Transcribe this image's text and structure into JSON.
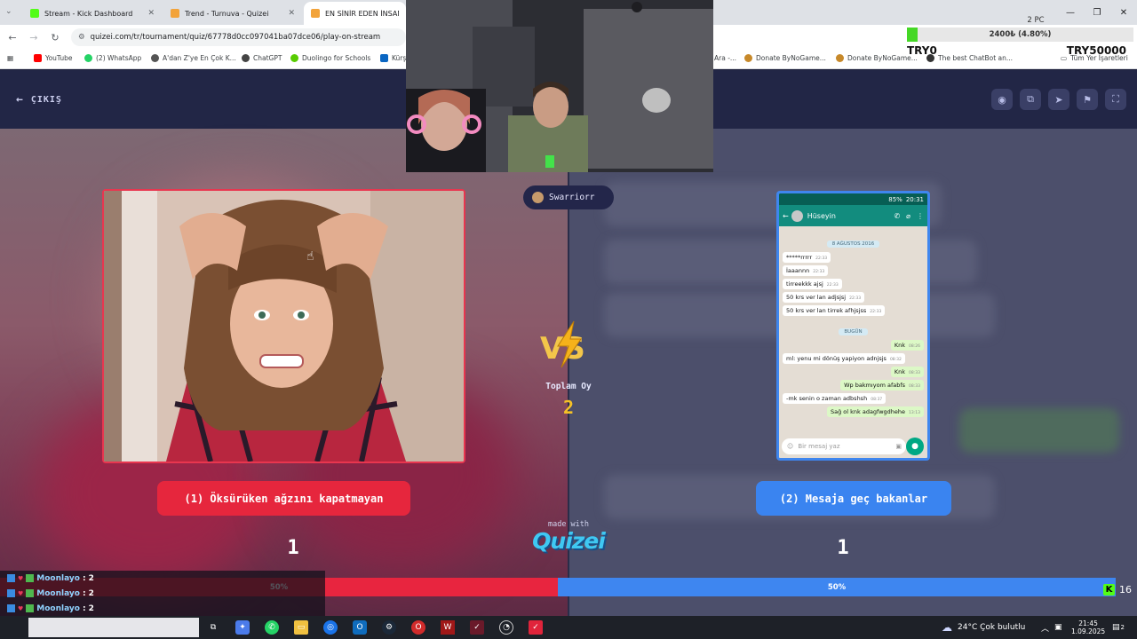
{
  "browser": {
    "tabs": [
      {
        "title": "Stream - Kick Dashboard",
        "color": "#53fc18"
      },
      {
        "title": "Trend - Turnuva - Quizei",
        "color": "#f2a33a"
      },
      {
        "title": "EN SİNİR EDEN İNSAN TİP",
        "color": "#f2a33a"
      }
    ],
    "url": "quizei.com/tr/tournament/quiz/67778d0cc097041ba07dce06/play-on-stream",
    "bookmarks": [
      {
        "label": "YouTube",
        "color": "#ff0000"
      },
      {
        "label": "(2) WhatsApp",
        "color": "#25d366"
      },
      {
        "label": "A'dan Z'ye En Çok K...",
        "color": "#555555"
      },
      {
        "label": "ChatGPT",
        "color": "#444444"
      },
      {
        "label": "Duolingo for Schools",
        "color": "#58cc02"
      },
      {
        "label": "Kürş",
        "color": "#0a66c2"
      },
      {
        "label": "Ara -...",
        "color": "#999999"
      },
      {
        "label": "Donate ByNoGame...",
        "color": "#c7892a"
      },
      {
        "label": "Donate ByNoGame...",
        "color": "#c7892a"
      },
      {
        "label": "The best ChatBot an...",
        "color": "#333333"
      },
      {
        "label": "Tüm Yer İşaretleri",
        "color": "#5f6368"
      }
    ]
  },
  "quiz": {
    "exit_label": "ÇIKIŞ",
    "left_option": "(1) Öksürüken ağzını kapatmayan",
    "right_option": "(2) Mesaja geç bakanlar",
    "left_count": "1",
    "right_count": "1",
    "user": "Swarriorr",
    "vs": "VS",
    "total_label": "Toplam Oy",
    "total_value": "2",
    "made_with": "made with",
    "brand": "Quizei",
    "left_percent": "50%",
    "right_percent": "50%",
    "left_share": 0.5,
    "colors": {
      "left": "#e8253f",
      "right": "#3e86f0",
      "accent": "#f5c126"
    }
  },
  "whatsapp": {
    "status_time": "20:31",
    "battery": "85%",
    "contact": "Hüseyin",
    "date_old": "8 AĞUSTOS 2016",
    "date_today": "BUGÜN",
    "input_placeholder": "Bir mesaj yaz",
    "messages": [
      {
        "side": "in",
        "text": "*****rrrrr",
        "time": "22:33"
      },
      {
        "side": "in",
        "text": "İaaannn",
        "time": "22:33"
      },
      {
        "side": "in",
        "text": "tirreekkk ajsj",
        "time": "22:33"
      },
      {
        "side": "in",
        "text": "50 krs ver lan adjsjsj",
        "time": "22:33"
      },
      {
        "side": "in",
        "text": "50 krs ver lan tirrek afhjsjss",
        "time": "22:33"
      },
      {
        "side": "out",
        "text": "Knk",
        "time": "08:26"
      },
      {
        "side": "in",
        "text": "ml: yenu mi dönüş yapiyon adnjsjs",
        "time": "08:32"
      },
      {
        "side": "out",
        "text": "Knk",
        "time": "08:33"
      },
      {
        "side": "out",
        "text": "Wp bakmıyom afabfs",
        "time": "08:33"
      },
      {
        "side": "in",
        "text": "-mk senin o zaman adbshsh",
        "time": "08:37"
      },
      {
        "side": "out",
        "text": "Sağ ol knk adagfwgdhehe",
        "time": "13:13"
      }
    ]
  },
  "chat": [
    {
      "user": "Moonlayo",
      "value": ": 2"
    },
    {
      "user": "Moonlayo",
      "value": ": 2"
    },
    {
      "user": "Moonlayo",
      "value": ": 2"
    }
  ],
  "kick_viewers": "16",
  "donation": {
    "pc_label": "2 PC",
    "progress_text": "2400₺ (4.80%)",
    "progress": 0.048,
    "min_label": "TRY0",
    "max_label": "TRY50000"
  },
  "taskbar": {
    "weather": "24°C  Çok bulutlu",
    "time": "21:45",
    "date": "1.09.2025",
    "notifications": "2"
  }
}
